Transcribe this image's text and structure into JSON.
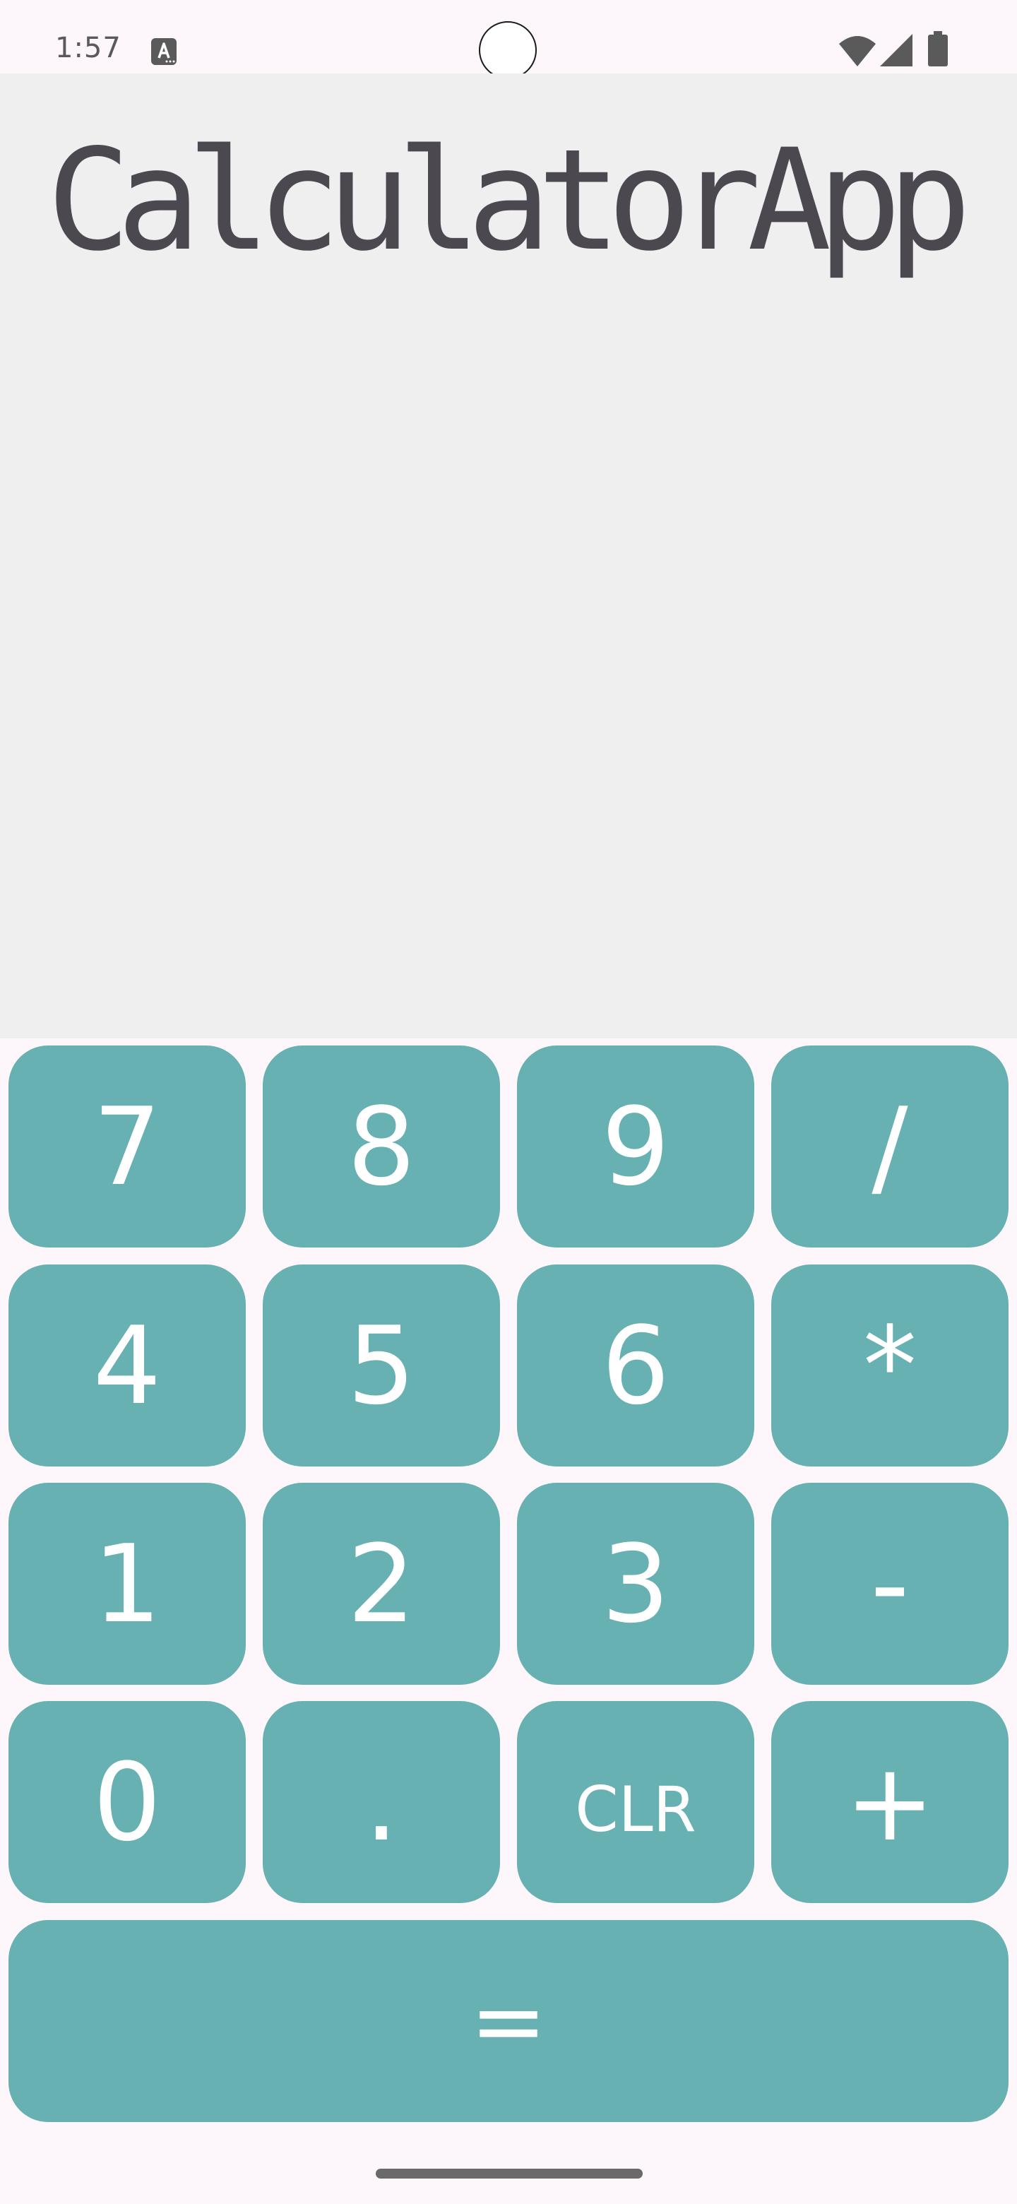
{
  "status_bar": {
    "time": "1:57",
    "icons": [
      "notification-a-icon",
      "wifi-icon",
      "cellular-signal-icon",
      "battery-icon"
    ]
  },
  "display": {
    "text": "CalculatorApp"
  },
  "keypad": {
    "rows": [
      [
        "7",
        "8",
        "9",
        "/"
      ],
      [
        "4",
        "5",
        "6",
        "*"
      ],
      [
        "1",
        "2",
        "3",
        "-"
      ],
      [
        "0",
        ".",
        "CLR",
        "+"
      ]
    ],
    "equals": "="
  },
  "colors": {
    "key_background": "#67b1b2",
    "key_text": "#ffffff",
    "display_background": "#efefef",
    "display_text": "#4b4850",
    "app_background": "#fdf6fb"
  }
}
